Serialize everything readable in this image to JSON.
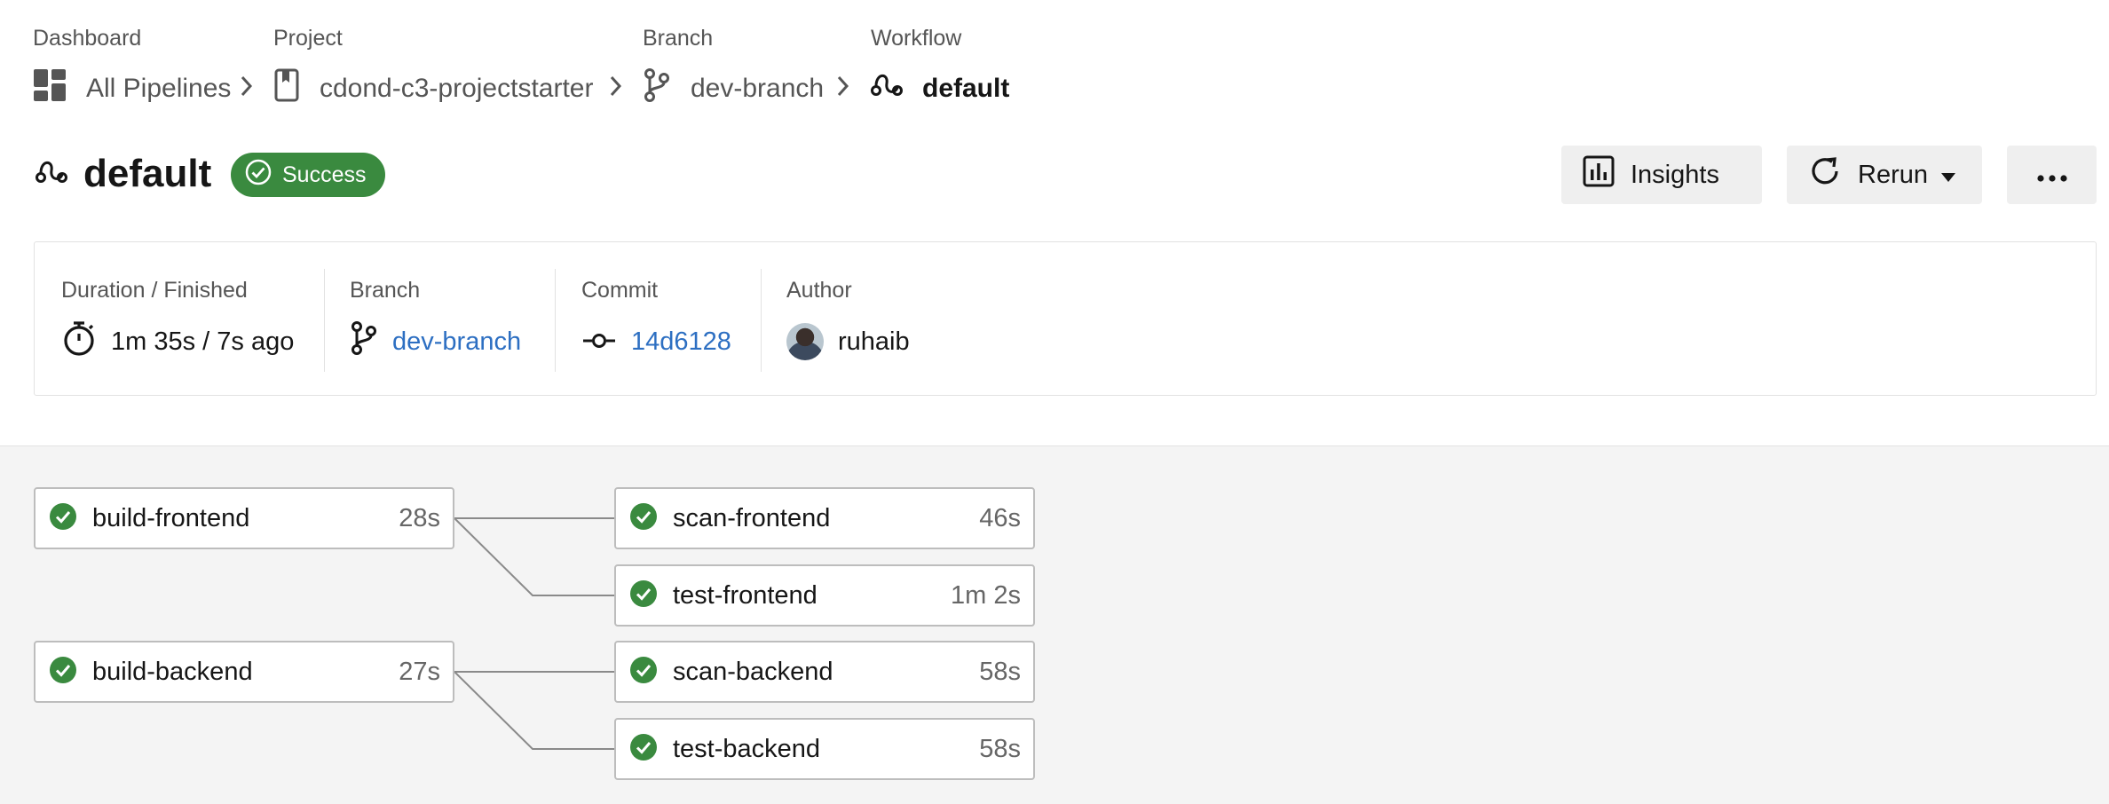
{
  "breadcrumb": {
    "dashboard": {
      "heading": "Dashboard",
      "label": "All Pipelines",
      "icon": "dashboard-icon"
    },
    "project": {
      "heading": "Project",
      "label": "cdond-c3-projectstarter",
      "icon": "bookmark-icon"
    },
    "branch": {
      "heading": "Branch",
      "label": "dev-branch",
      "icon": "git-branch-icon"
    },
    "workflow": {
      "heading": "Workflow",
      "label": "default",
      "icon": "workflow-icon"
    }
  },
  "header": {
    "title": "default",
    "status": "Success",
    "status_color": "#3a8a3f",
    "insights_label": "Insights",
    "rerun_label": "Rerun"
  },
  "summary": {
    "duration": {
      "heading": "Duration / Finished",
      "value": "1m 35s / 7s ago",
      "icon": "stopwatch-icon"
    },
    "branch": {
      "heading": "Branch",
      "value": "dev-branch",
      "icon": "git-branch-icon"
    },
    "commit": {
      "heading": "Commit",
      "value": "14d6128",
      "icon": "commit-icon"
    },
    "author": {
      "heading": "Author",
      "value": "ruhaib",
      "icon": "avatar"
    }
  },
  "jobs": [
    {
      "name": "build-frontend",
      "duration": "28s",
      "status": "success"
    },
    {
      "name": "scan-frontend",
      "duration": "46s",
      "status": "success"
    },
    {
      "name": "test-frontend",
      "duration": "1m 2s",
      "status": "success"
    },
    {
      "name": "build-backend",
      "duration": "27s",
      "status": "success"
    },
    {
      "name": "scan-backend",
      "duration": "58s",
      "status": "success"
    },
    {
      "name": "test-backend",
      "duration": "58s",
      "status": "success"
    }
  ],
  "colors": {
    "accent_link": "#2d6fc2",
    "success": "#3a8a3f"
  }
}
